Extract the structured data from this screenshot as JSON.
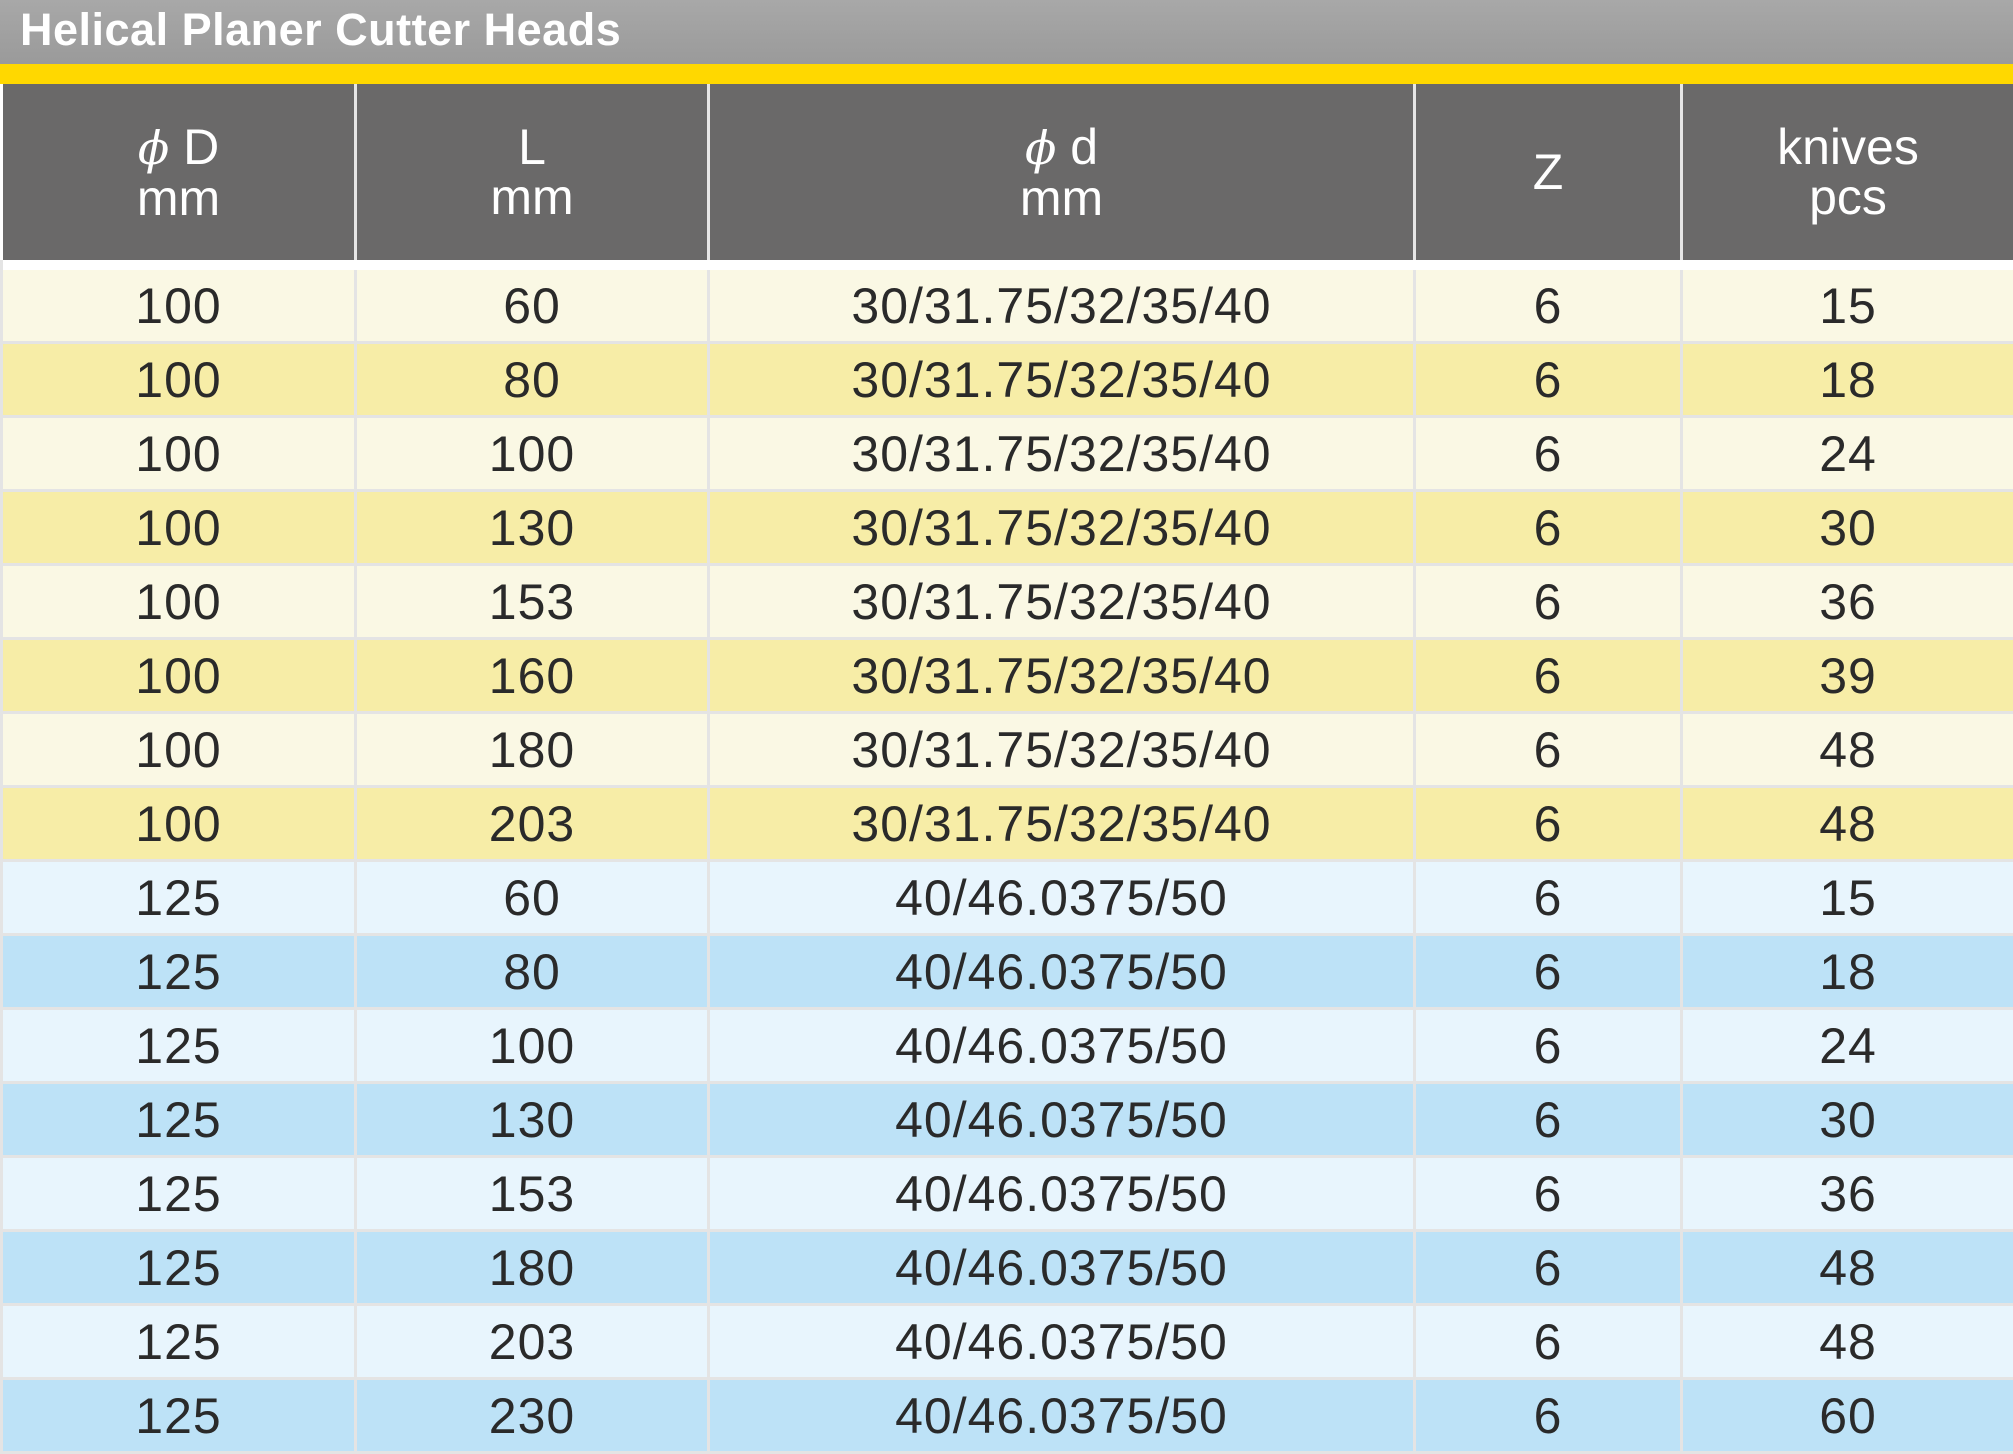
{
  "title": "Helical Planer Cutter Heads",
  "colors": {
    "title_bar": "#9e9e9e",
    "accent_stripe": "#ffd800",
    "header_bg": "#6a6969",
    "row_yellow_light": "#faf8e4",
    "row_yellow_dark": "#f7eda7",
    "row_blue_light": "#e8f5fd",
    "row_blue_dark": "#bde2f7"
  },
  "headers": [
    {
      "symbol": "ϕ",
      "line1": "D",
      "line2": "mm"
    },
    {
      "symbol": "",
      "line1": "L",
      "line2": "mm"
    },
    {
      "symbol": "ϕ",
      "line1": "d",
      "line2": "mm"
    },
    {
      "symbol": "",
      "line1": "Z",
      "line2": ""
    },
    {
      "symbol": "",
      "line1": "knives",
      "line2": "pcs"
    }
  ],
  "rows": [
    {
      "D": "100",
      "L": "60",
      "d": "30/31.75/32/35/40",
      "Z": "6",
      "knives": "15",
      "group": "y-light"
    },
    {
      "D": "100",
      "L": "80",
      "d": "30/31.75/32/35/40",
      "Z": "6",
      "knives": "18",
      "group": "y-dark"
    },
    {
      "D": "100",
      "L": "100",
      "d": "30/31.75/32/35/40",
      "Z": "6",
      "knives": "24",
      "group": "y-light"
    },
    {
      "D": "100",
      "L": "130",
      "d": "30/31.75/32/35/40",
      "Z": "6",
      "knives": "30",
      "group": "y-dark"
    },
    {
      "D": "100",
      "L": "153",
      "d": "30/31.75/32/35/40",
      "Z": "6",
      "knives": "36",
      "group": "y-light"
    },
    {
      "D": "100",
      "L": "160",
      "d": "30/31.75/32/35/40",
      "Z": "6",
      "knives": "39",
      "group": "y-dark"
    },
    {
      "D": "100",
      "L": "180",
      "d": "30/31.75/32/35/40",
      "Z": "6",
      "knives": "48",
      "group": "y-light"
    },
    {
      "D": "100",
      "L": "203",
      "d": "30/31.75/32/35/40",
      "Z": "6",
      "knives": "48",
      "group": "y-dark"
    },
    {
      "D": "125",
      "L": "60",
      "d": "40/46.0375/50",
      "Z": "6",
      "knives": "15",
      "group": "b-light"
    },
    {
      "D": "125",
      "L": "80",
      "d": "40/46.0375/50",
      "Z": "6",
      "knives": "18",
      "group": "b-dark"
    },
    {
      "D": "125",
      "L": "100",
      "d": "40/46.0375/50",
      "Z": "6",
      "knives": "24",
      "group": "b-light"
    },
    {
      "D": "125",
      "L": "130",
      "d": "40/46.0375/50",
      "Z": "6",
      "knives": "30",
      "group": "b-dark"
    },
    {
      "D": "125",
      "L": "153",
      "d": "40/46.0375/50",
      "Z": "6",
      "knives": "36",
      "group": "b-light"
    },
    {
      "D": "125",
      "L": "180",
      "d": "40/46.0375/50",
      "Z": "6",
      "knives": "48",
      "group": "b-dark"
    },
    {
      "D": "125",
      "L": "203",
      "d": "40/46.0375/50",
      "Z": "6",
      "knives": "48",
      "group": "b-light"
    },
    {
      "D": "125",
      "L": "230",
      "d": "40/46.0375/50",
      "Z": "6",
      "knives": "60",
      "group": "b-dark"
    }
  ]
}
